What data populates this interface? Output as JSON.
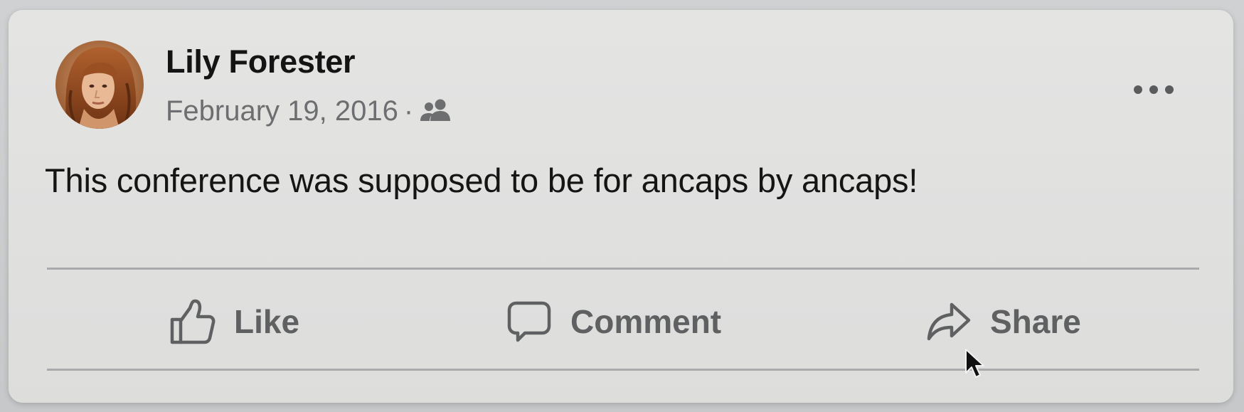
{
  "post": {
    "author": "Lily Forester",
    "date": "February 19, 2016",
    "separator": "·",
    "audience_icon": "friends-icon",
    "text": "This conference was supposed to be for ancaps by ancaps!"
  },
  "actions": {
    "like": {
      "label": "Like",
      "icon": "thumbs-up-icon"
    },
    "comment": {
      "label": "Comment",
      "icon": "comment-bubble-icon"
    },
    "share": {
      "label": "Share",
      "icon": "share-arrow-icon"
    }
  },
  "menu": {
    "icon": "more-options-icon"
  },
  "colors": {
    "card_background": "#e2e2e1",
    "name_text": "#141414",
    "meta_text": "#6d6e70",
    "action_text": "#5f6062",
    "divider": "#a9aaab"
  }
}
